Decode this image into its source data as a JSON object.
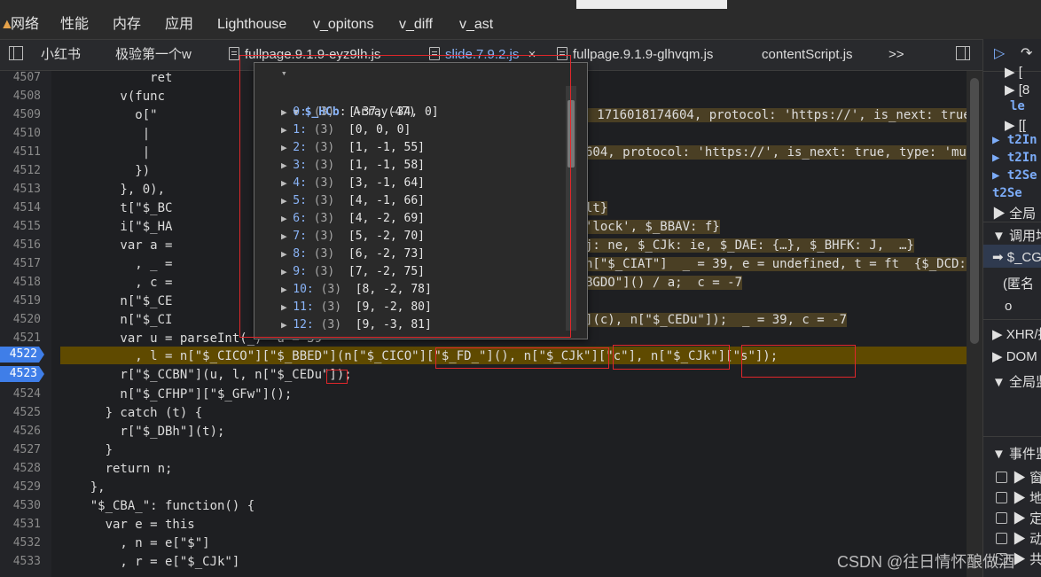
{
  "main_tabs": [
    "网络",
    "性能",
    "内存",
    "应用",
    "Lighthouse",
    "v_opitons",
    "v_diff",
    "v_ast"
  ],
  "file_tabs": [
    {
      "label": "小红书",
      "active": false
    },
    {
      "label": "极验第一个w",
      "active": false
    },
    {
      "label": "fullpage.9.1.9-eyz9lh.js",
      "active": false
    },
    {
      "label": "slide.7.9.2.js",
      "active": true,
      "close": "×"
    },
    {
      "label": "fullpage.9.1.9-glhvqm.js",
      "active": false
    },
    {
      "label": "contentScript.js",
      "active": false
    }
  ],
  "tab_overflow": ">>",
  "line_numbers": [
    "4507",
    "4508",
    "4509",
    "4510",
    "4511",
    "4512",
    "4513",
    "4514",
    "4515",
    "4516",
    "4517",
    "4518",
    "4519",
    "4520",
    "4521",
    "4522",
    "4523",
    "4524",
    "4525",
    "4526",
    "4527",
    "4528",
    "4529",
    "4530",
    "4531",
    "4532",
    "4533"
  ],
  "breakpoints": [
    "4522",
    "4523"
  ],
  "code_lines": [
    "            ret",
    "        v(func",
    "          o[\"",
    "           |",
    "           |",
    "          })",
    "        }, 0),",
    "        t[\"$_BC",
    "        i[\"$_HA",
    "        var a =",
    "          , _ =",
    "          , c =",
    "        n[\"$_CE",
    "        n[\"$_CI",
    "        var u = parseInt(_)  u = 39",
    "          , l = n[\"$_CICO\"][\"$_BBED\"](n[\"$_CICO\"][\"$_FD_\"](), n[\"$_CJk\"][\"c\"], n[\"$_CJk\"][\"s\"]);",
    "        r[\"$_CCBN\"](u, l, n[\"$_CEDu\"]);",
    "        n[\"$_CFHP\"][\"$_GFw\"]();",
    "      } catch (t) {",
    "        r[\"$_DBh\"](t);",
    "      }",
    "      return n;",
    "    },",
    "    \"$_CBA_\": function() {",
    "      var e = this",
    "        , n = e[\"$\"]",
    "        , r = e[\"$_CJk\"]"
  ],
  "inline_values": {
    "l4509": "F: 1716018174604, protocol: 'https://', is_next: true,",
    "l4511": "604, protocol: 'https://', is_next: true, type: 'multi",
    "l4514": "lt}",
    "l4515": "'lock', $_BBAV: f}",
    "l4516": "j: ne, $_CJk: ie, $_DAE: {…}, $_BHFK: J,  …}",
    "l4517": "n[\"$_CIAT\"]  _ = 39, e = undefined, t = ft  {$_DCD: F",
    "l4518": "BGDO\"]() / a;  c = -7",
    "l4520": "](c), n[\"$_CEDu\"]);  _ = 39, c = -7"
  },
  "popup": {
    "title_var": "$_HCb",
    "title_type": "Array(47)",
    "items": [
      {
        "idx": "0",
        "count": "(3)",
        "value": "[-37, -34, 0]"
      },
      {
        "idx": "1",
        "count": "(3)",
        "value": "[0, 0, 0]"
      },
      {
        "idx": "2",
        "count": "(3)",
        "value": "[1, -1, 55]"
      },
      {
        "idx": "3",
        "count": "(3)",
        "value": "[1, -1, 58]"
      },
      {
        "idx": "4",
        "count": "(3)",
        "value": "[3, -1, 64]"
      },
      {
        "idx": "5",
        "count": "(3)",
        "value": "[4, -1, 66]"
      },
      {
        "idx": "6",
        "count": "(3)",
        "value": "[4, -2, 69]"
      },
      {
        "idx": "7",
        "count": "(3)",
        "value": "[5, -2, 70]"
      },
      {
        "idx": "8",
        "count": "(3)",
        "value": "[6, -2, 73]"
      },
      {
        "idx": "9",
        "count": "(3)",
        "value": "[7, -2, 75]"
      },
      {
        "idx": "10",
        "count": "(3)",
        "value": "[8, -2, 78]"
      },
      {
        "idx": "11",
        "count": "(3)",
        "value": "[9, -2, 80]"
      },
      {
        "idx": "12",
        "count": "(3)",
        "value": "[9, -3, 81]"
      }
    ]
  },
  "right_panel": {
    "items": [
      {
        "text": "▶ [",
        "style": "plain"
      },
      {
        "text": "▶ [8",
        "style": "plain"
      },
      {
        "text": "  le",
        "style": "blue"
      },
      {
        "text": "▶ [[",
        "style": "plain"
      },
      {
        "text": "▶ t2In",
        "style": "blue"
      },
      {
        "text": "▶ t2In",
        "style": "blue"
      },
      {
        "text": "▶ t2Se",
        "style": "blue"
      },
      {
        "text": "  t2Se",
        "style": "blue"
      },
      {
        "text": "▶ 全局",
        "style": "plain"
      },
      {
        "text": "▼ 调用堆",
        "style": "plain"
      },
      {
        "text": "➡ $_CGI",
        "style": "plain"
      },
      {
        "text": "  (匿名",
        "style": "plain"
      },
      {
        "text": "o",
        "style": "plain"
      },
      {
        "text": "▶ XHR/提",
        "style": "plain"
      },
      {
        "text": "▶ DOM",
        "style": "plain"
      },
      {
        "text": "▼ 全局监",
        "style": "plain"
      },
      {
        "text": "▼ 事件监",
        "style": "plain"
      },
      {
        "text": "▶ 窗",
        "style": "check"
      },
      {
        "text": "▶ 地",
        "style": "check"
      },
      {
        "text": "▶ 定",
        "style": "check"
      },
      {
        "text": "▶ 动",
        "style": "check"
      },
      {
        "text": "▶ 共",
        "style": "check"
      }
    ]
  },
  "watermark": "CSDN @往日情怀酿做酒"
}
